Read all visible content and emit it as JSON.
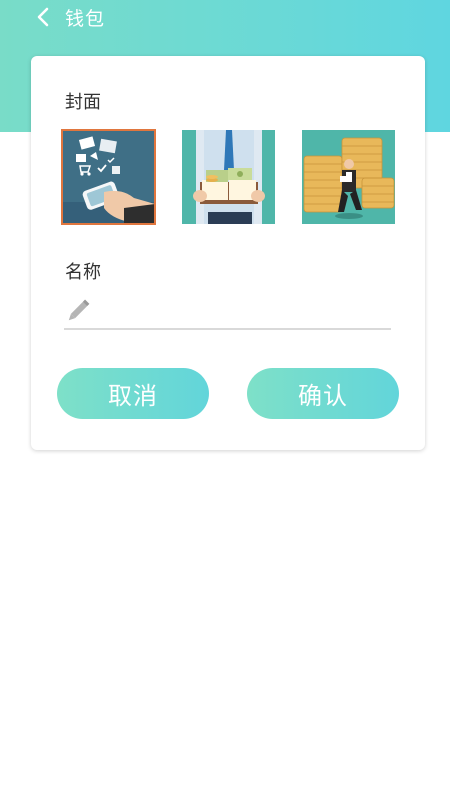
{
  "header": {
    "title": "钱包",
    "back_icon": "chevron-left-icon",
    "gradient": [
      "#79dcc8",
      "#5fd6e0"
    ]
  },
  "form": {
    "cover_label": "封面",
    "covers": [
      {
        "name": "cover-mobile-payment",
        "selected": true
      },
      {
        "name": "cover-businessman-money-book",
        "selected": false
      },
      {
        "name": "cover-businessman-coin-stacks",
        "selected": false
      }
    ],
    "selected_border_color": "#e0763e",
    "name_label": "名称",
    "name_value": "",
    "name_icon": "pencil-icon"
  },
  "actions": {
    "cancel_label": "取消",
    "confirm_label": "确认"
  }
}
